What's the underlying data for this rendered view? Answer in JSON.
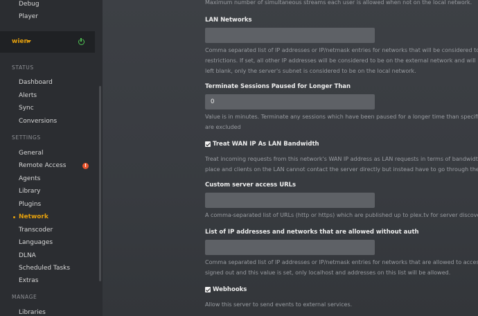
{
  "sidebar": {
    "top_items": [
      "Debug",
      "Player"
    ],
    "server": {
      "name": "wien",
      "status_icon": "power-icon",
      "status_color": "#4fc352"
    },
    "status_heading": "STATUS",
    "status_items": [
      "Dashboard",
      "Alerts",
      "Sync",
      "Conversions"
    ],
    "settings_heading": "SETTINGS",
    "settings_items": [
      "General",
      "Remote Access",
      "Agents",
      "Library",
      "Plugins",
      "Network",
      "Transcoder",
      "Languages",
      "DLNA",
      "Scheduled Tasks",
      "Extras"
    ],
    "active_item": "Network",
    "warning_icon": "!",
    "manage_heading": "MANAGE",
    "manage_items": [
      "Libraries"
    ]
  },
  "colors": {
    "accent": "#e5a00d",
    "warning": "#e8542d",
    "ok": "#4fc352"
  },
  "main": {
    "top_help": "Maximum number of simultaneous streams each user is allowed when not on the local network.",
    "lan_networks": {
      "label": "LAN Networks",
      "value": "",
      "help": [
        "Comma separated list of IP addresses or IP/netmask entries for networks that will be considered to be",
        "restrictions. If set, all other IP addresses will be considered to be on the external network and will be su",
        "left blank, only the server's subnet is considered to be on the local network."
      ]
    },
    "terminate_sessions": {
      "label": "Terminate Sessions Paused for Longer Than",
      "value": "0",
      "help": [
        "Value is in minutes. Terminate any sessions which have been paused for a longer time than specified a",
        "are excluded"
      ]
    },
    "treat_wan": {
      "label": "Treat WAN IP As LAN Bandwidth",
      "checked": true,
      "help": [
        "Treat incoming requests from this network's WAN IP address as LAN requests in terms of bandwidth. Th",
        "place and clients on the LAN cannot contact the server directly but instead have to go through the WAN"
      ]
    },
    "custom_urls": {
      "label": "Custom server access URLs",
      "value": "",
      "help": [
        "A comma-separated list of URLs (http or https) which are published up to plex.tv for server discovery."
      ]
    },
    "allowed_networks": {
      "label": "List of IP addresses and networks that are allowed without auth",
      "value": "",
      "help": [
        "Comma separated list of IP addresses or IP/netmask entries for networks that are allowed to access Ple",
        "signed out and this value is set, only localhost and addresses on this list will be allowed."
      ]
    },
    "webhooks": {
      "label": "Webhooks",
      "checked": true,
      "help": [
        "Allow this server to send events to external services."
      ]
    }
  }
}
